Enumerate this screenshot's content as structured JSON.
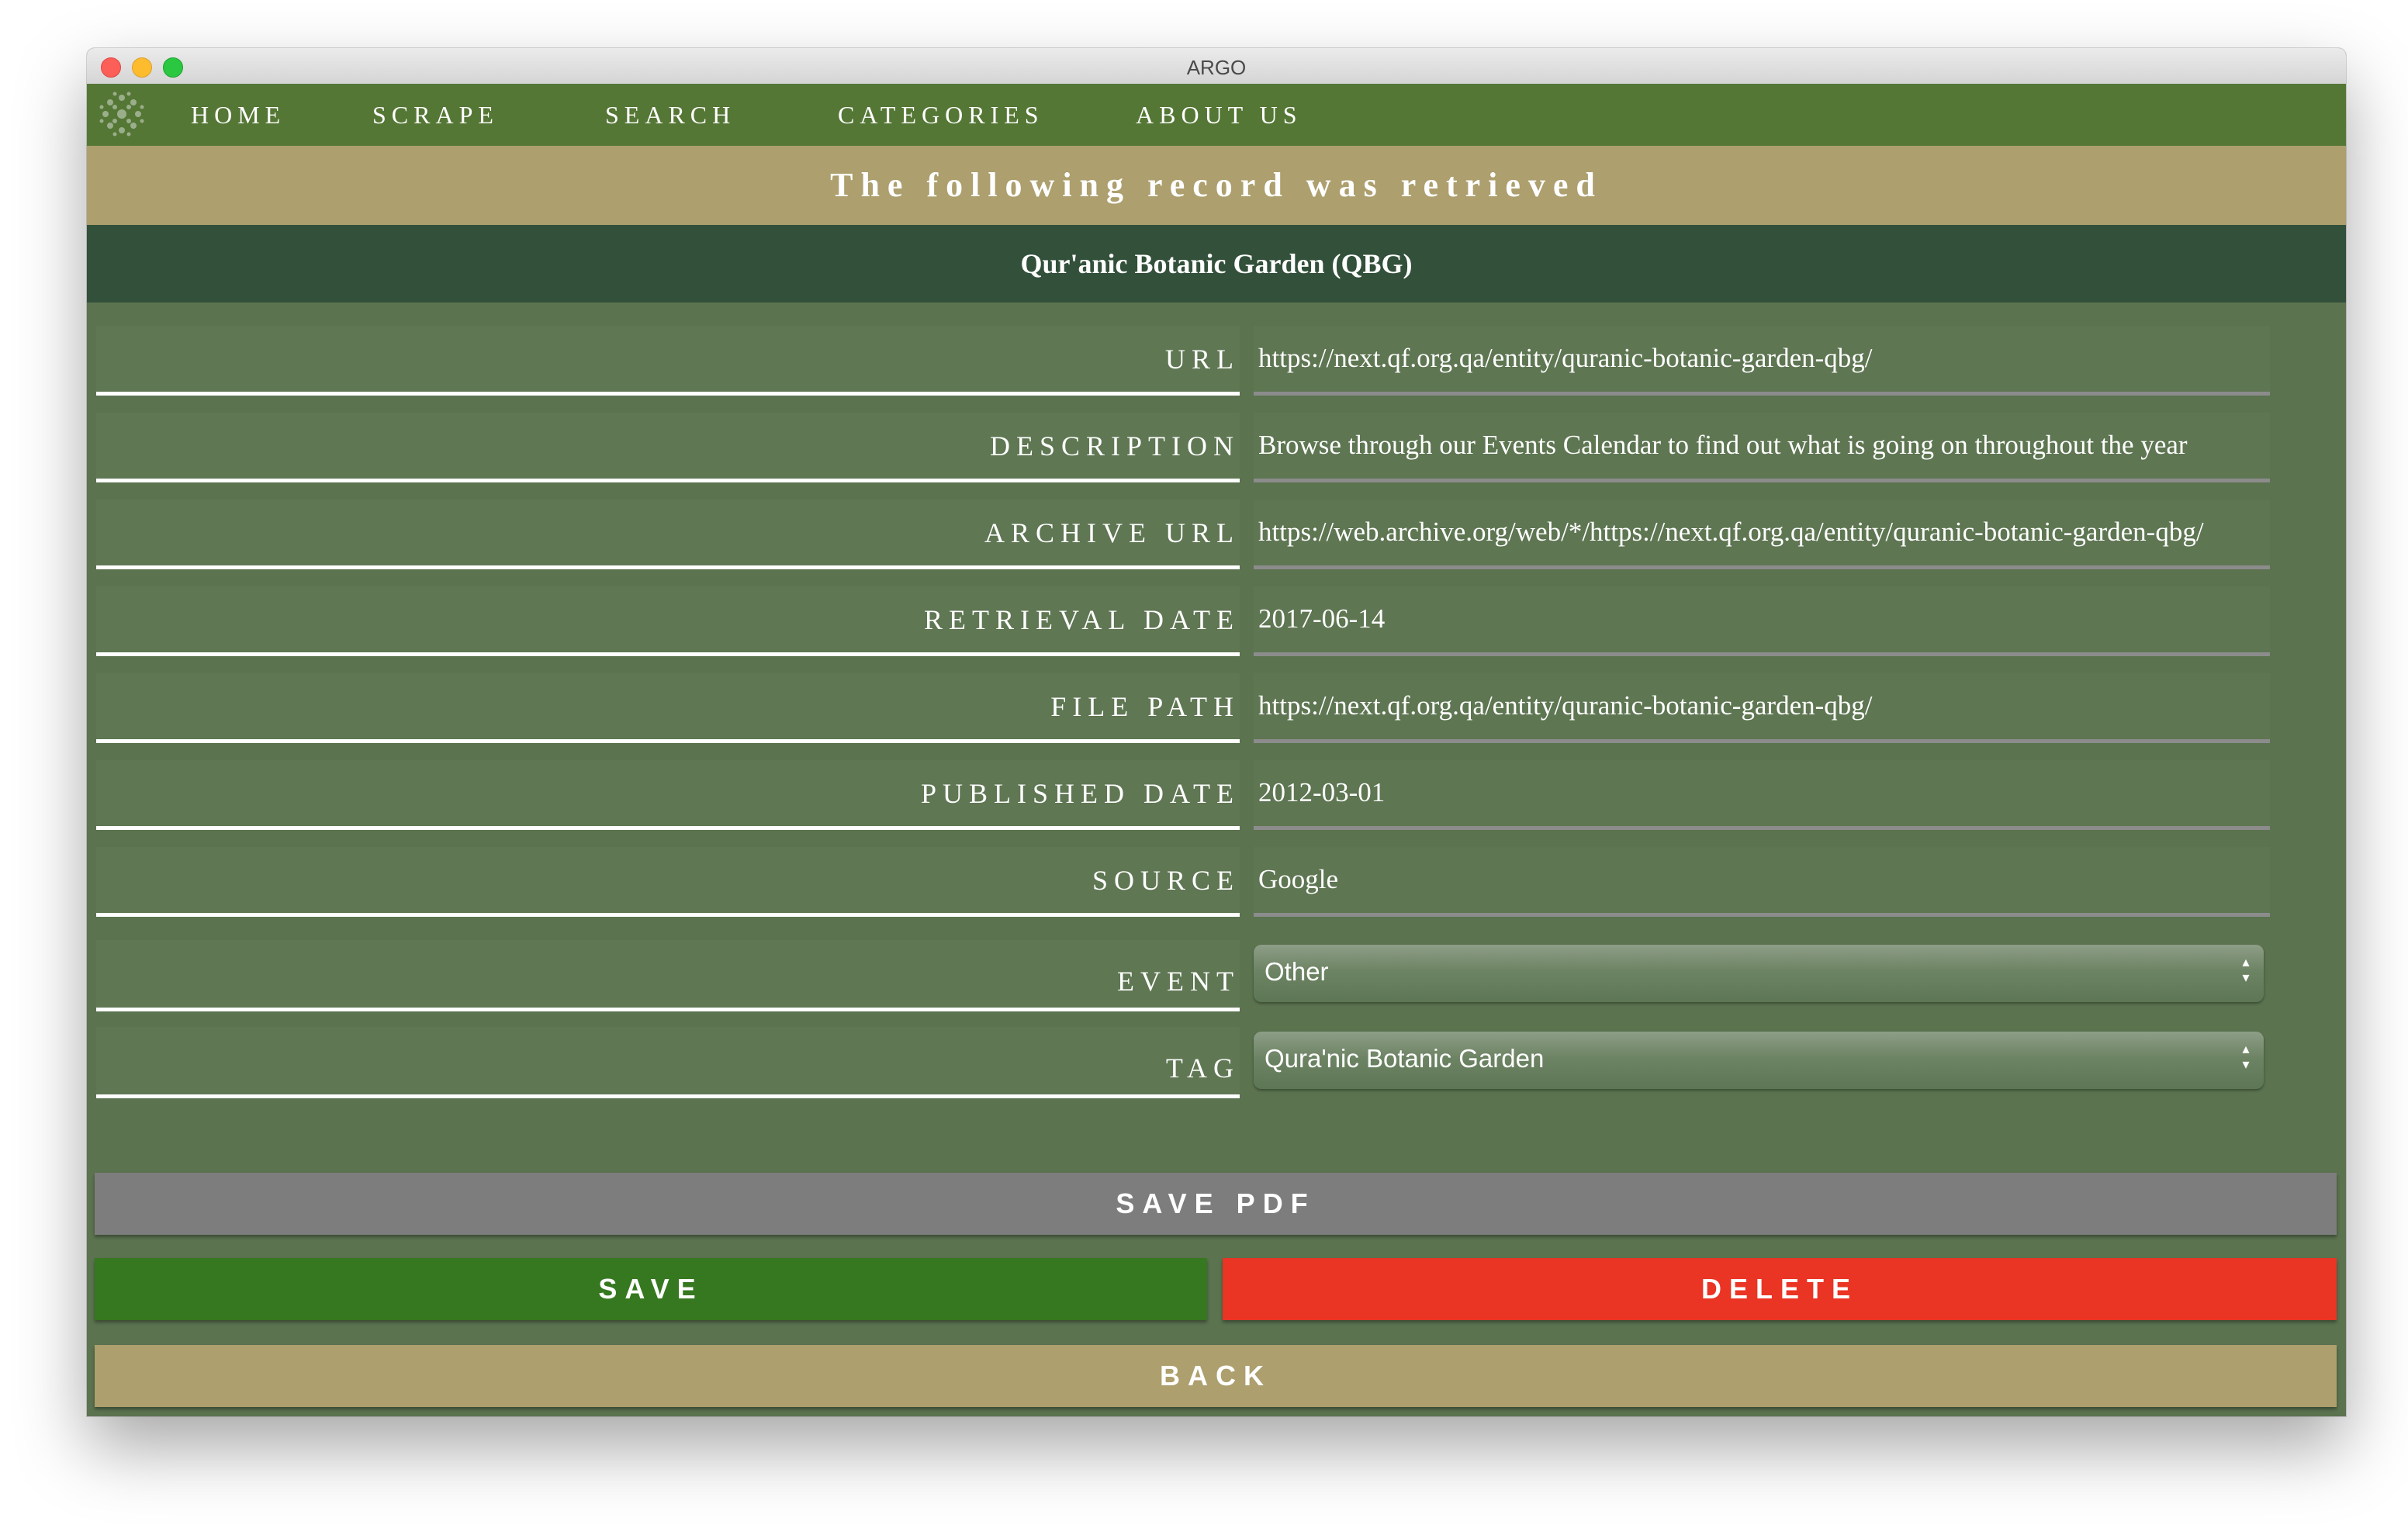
{
  "window": {
    "title": "ARGO"
  },
  "nav": {
    "items": [
      "HOME",
      "SCRAPE",
      "SEARCH",
      "CATEGORIES",
      "ABOUT US"
    ]
  },
  "banner": {
    "text": "The following record was retrieved"
  },
  "record": {
    "title": "Qur'anic Botanic Garden (QBG)",
    "fields": [
      {
        "label": "URL",
        "value": "https://next.qf.org.qa/entity/quranic-botanic-garden-qbg/"
      },
      {
        "label": "DESCRIPTION",
        "value": "Browse through our Events Calendar to find out what is going on throughout the year"
      },
      {
        "label": "ARCHIVE URL",
        "value": "https://web.archive.org/web/*/https://next.qf.org.qa/entity/quranic-botanic-garden-qbg/"
      },
      {
        "label": "RETRIEVAL DATE",
        "value": "2017-06-14"
      },
      {
        "label": "FILE PATH",
        "value": "https://next.qf.org.qa/entity/quranic-botanic-garden-qbg/"
      },
      {
        "label": "PUBLISHED DATE",
        "value": "2012-03-01"
      },
      {
        "label": "SOURCE",
        "value": "Google"
      }
    ],
    "selects": [
      {
        "label": "EVENT",
        "value": "Other"
      },
      {
        "label": "TAG",
        "value": "Qura'nic Botanic Garden"
      }
    ]
  },
  "buttons": {
    "save_pdf": "SAVE PDF",
    "save": "SAVE",
    "delete": "DELETE",
    "back": "BACK"
  },
  "colors": {
    "nav": "#557735",
    "banner": "#ad9f6e",
    "title_bar": "#32503a",
    "body": "#5b734f",
    "save": "#36781f",
    "delete": "#ea3424",
    "save_pdf": "#7d7d7d",
    "back": "#ad9f6e"
  }
}
